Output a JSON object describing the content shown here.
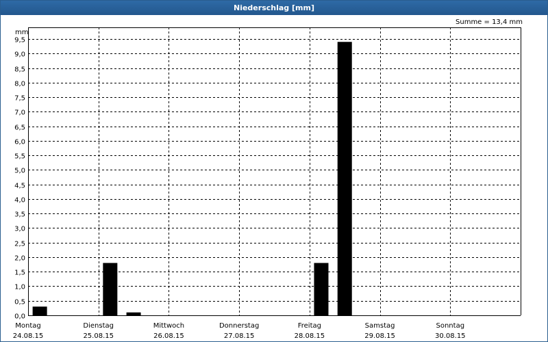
{
  "window": {
    "title": "Niederschlag [mm]"
  },
  "summary": {
    "text": "Summe = 13,4 mm"
  },
  "chart_data": {
    "type": "bar",
    "ylabel": "mm",
    "ylim": [
      0,
      9.5
    ],
    "y_ticks": [
      "0,0",
      "0,5",
      "1,0",
      "1,5",
      "2,0",
      "2,5",
      "3,0",
      "3,5",
      "4,0",
      "4,5",
      "5,0",
      "5,5",
      "6,0",
      "6,5",
      "7,0",
      "7,5",
      "8,0",
      "8,5",
      "9,0",
      "9,5"
    ],
    "days": [
      {
        "name": "Montag",
        "date": "24.08.15"
      },
      {
        "name": "Dienstag",
        "date": "25.08.15"
      },
      {
        "name": "Mittwoch",
        "date": "26.08.15"
      },
      {
        "name": "Donnerstag",
        "date": "27.08.15"
      },
      {
        "name": "Freitag",
        "date": "28.08.15"
      },
      {
        "name": "Samstag",
        "date": "29.08.15"
      },
      {
        "name": "Sonntag",
        "date": "30.08.15"
      }
    ],
    "bars_per_day": 3,
    "values": [
      0.3,
      0,
      0,
      1.8,
      0.1,
      0,
      0,
      0,
      0,
      0,
      0,
      0,
      1.8,
      9.4,
      0,
      0,
      0,
      0,
      0,
      0,
      0
    ],
    "grid": true,
    "bar_color": "#000000",
    "grid_color": "#000000"
  }
}
